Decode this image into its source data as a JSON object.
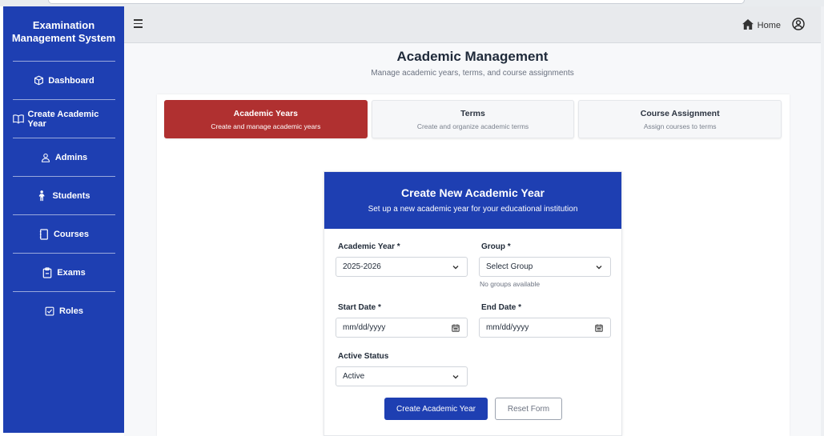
{
  "sidebar": {
    "brand_line1": "Examination",
    "brand_line2": "Management System",
    "items": [
      {
        "label": "Dashboard",
        "icon": "cube-icon"
      },
      {
        "label": "Create Academic Year",
        "icon": "book-icon"
      },
      {
        "label": "Admins",
        "icon": "user-icon"
      },
      {
        "label": "Students",
        "icon": "student-icon"
      },
      {
        "label": "Courses",
        "icon": "notebook-icon"
      },
      {
        "label": "Exams",
        "icon": "clipboard-icon"
      },
      {
        "label": "Roles",
        "icon": "checkbox-icon"
      }
    ]
  },
  "header": {
    "home_label": "Home"
  },
  "main": {
    "title": "Academic Management",
    "subtitle": "Manage academic years, terms, and course assignments",
    "tabs": [
      {
        "title": "Academic Years",
        "subtitle": "Create and manage academic years",
        "active": true
      },
      {
        "title": "Terms",
        "subtitle": "Create and organize academic terms",
        "active": false
      },
      {
        "title": "Course Assignment",
        "subtitle": "Assign courses to terms",
        "active": false
      }
    ]
  },
  "form": {
    "title": "Create New Academic Year",
    "subtitle": "Set up a new academic year for your educational institution",
    "academic_year_label": "Academic Year *",
    "academic_year_value": "2025-2026",
    "group_label": "Group *",
    "group_value": "Select Group",
    "group_helper": "No groups available",
    "start_date_label": "Start Date *",
    "start_date_placeholder": "mm/dd/yyyy",
    "end_date_label": "End Date *",
    "end_date_placeholder": "mm/dd/yyyy",
    "active_status_label": "Active Status",
    "active_status_value": "Active",
    "submit_label": "Create Academic Year",
    "reset_label": "Reset Form"
  },
  "colors": {
    "primary_blue": "#1e3fb2",
    "active_tab_red": "#b03030"
  }
}
